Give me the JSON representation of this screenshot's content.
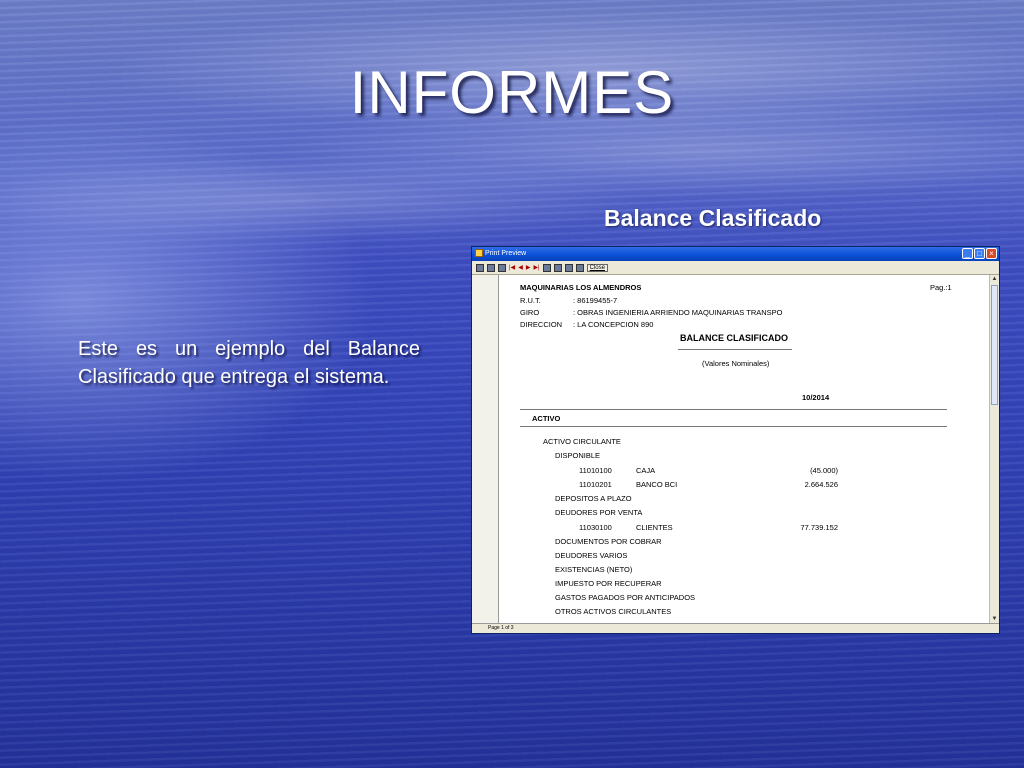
{
  "slide": {
    "title": "INFORMES",
    "subtitle": "Balance Clasificado",
    "description": "Este es un ejemplo del Balance Clasificado que entrega el sistema."
  },
  "window": {
    "title": "Print Preview",
    "close_label": "Close",
    "status": "Page 1 of 3",
    "icons": [
      "app-icon",
      "minimize-icon",
      "maximize-icon",
      "close-icon"
    ]
  },
  "report": {
    "company": "MAQUINARIAS LOS ALMENDROS",
    "page": "Pag.:1",
    "rut_label": "R.U.T.",
    "rut_value": ": 86199455-7",
    "giro_label": "GIRO",
    "giro_value": ": OBRAS INGENIERIA ARRIENDO MAQUINARIAS TRANSPO",
    "direccion_label": "DIRECCION",
    "direccion_value": ": LA CONCEPCION 890",
    "title": "BALANCE CLASIFICADO",
    "subtitle": "(Valores Nominales)",
    "period": "10/2014",
    "section": "ACTIVO",
    "group": "ACTIVO CIRCULANTE",
    "lines": {
      "disponible": "DISPONIBLE",
      "caja_code": "11010100",
      "caja_name": "CAJA",
      "caja_value": "(45.000)",
      "banco_code": "11010201",
      "banco_name": "BANCO BCI",
      "banco_value": "2.664.526",
      "depositos": "DEPOSITOS A PLAZO",
      "deudores_venta": "DEUDORES POR VENTA",
      "clientes_code": "11030100",
      "clientes_name": "CLIENTES",
      "clientes_value": "77.739.152",
      "documentos": "DOCUMENTOS POR COBRAR",
      "deudores_varios": "DEUDORES VARIOS",
      "existencias": "EXISTENCIAS (NETO)",
      "impuesto": "IMPUESTO POR RECUPERAR",
      "gastos": "GASTOS PAGADOS POR ANTICIPADOS",
      "otros": "OTROS ACTIVOS CIRCULANTES"
    }
  }
}
